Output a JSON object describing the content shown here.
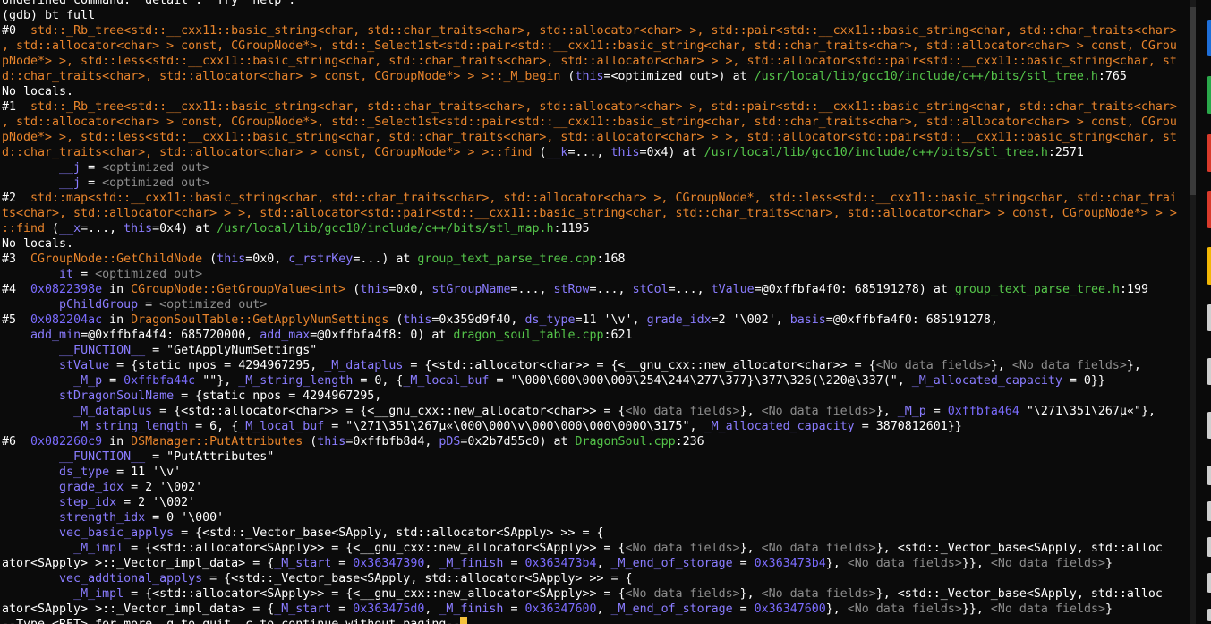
{
  "terminal": {
    "cursor_color": "#f5c23b",
    "lines": [
      [
        {
          "t": "Undefined command: \"detail\".  Try \"help\".",
          "c": "plain"
        }
      ],
      [
        {
          "t": "(gdb) bt full",
          "c": "plain"
        }
      ],
      [
        {
          "t": "#0  ",
          "c": "plain"
        },
        {
          "t": "std::_Rb_tree<std::__cxx11::basic_string<char, std::char_traits<char>, std::allocator<char> >, std::pair<std::__cxx11::basic_string<char, std::char_traits<char>",
          "c": "func"
        }
      ],
      [
        {
          "t": ", std::allocator<char> > const, CGroupNode*>, std::_Select1st<std::pair<std::__cxx11::basic_string<char, std::char_traits<char>, std::allocator<char> > const, CGrou",
          "c": "func"
        }
      ],
      [
        {
          "t": "pNode*> >, std::less<std::__cxx11::basic_string<char, std::char_traits<char>, std::allocator<char> > >, std::allocator<std::pair<std::__cxx11::basic_string<char, st",
          "c": "func"
        }
      ],
      [
        {
          "t": "d::char_traits<char>, std::allocator<char> > const, CGroupNode*> > >::_M_begin",
          "c": "func"
        },
        {
          "t": " (",
          "c": "plain"
        },
        {
          "t": "this",
          "c": "arg"
        },
        {
          "t": "=<optimized out>) at ",
          "c": "plain"
        },
        {
          "t": "/usr/local/lib/gcc10/include/c++/bits/stl_tree.h",
          "c": "file"
        },
        {
          "t": ":765",
          "c": "plain"
        }
      ],
      [
        {
          "t": "No locals.",
          "c": "plain"
        }
      ],
      [
        {
          "t": "#1  ",
          "c": "plain"
        },
        {
          "t": "std::_Rb_tree<std::__cxx11::basic_string<char, std::char_traits<char>, std::allocator<char> >, std::pair<std::__cxx11::basic_string<char, std::char_traits<char>",
          "c": "func"
        }
      ],
      [
        {
          "t": ", std::allocator<char> > const, CGroupNode*>, std::_Select1st<std::pair<std::__cxx11::basic_string<char, std::char_traits<char>, std::allocator<char> > const, CGrou",
          "c": "func"
        }
      ],
      [
        {
          "t": "pNode*> >, std::less<std::__cxx11::basic_string<char, std::char_traits<char>, std::allocator<char> > >, std::allocator<std::pair<std::__cxx11::basic_string<char, st",
          "c": "func"
        }
      ],
      [
        {
          "t": "d::char_traits<char>, std::allocator<char> > const, CGroupNode*> > >::find",
          "c": "func"
        },
        {
          "t": " (",
          "c": "plain"
        },
        {
          "t": "__k",
          "c": "arg"
        },
        {
          "t": "=..., ",
          "c": "plain"
        },
        {
          "t": "this",
          "c": "arg"
        },
        {
          "t": "=0x4) at ",
          "c": "plain"
        },
        {
          "t": "/usr/local/lib/gcc10/include/c++/bits/stl_tree.h",
          "c": "file"
        },
        {
          "t": ":2571",
          "c": "plain"
        }
      ],
      [
        {
          "t": "        ",
          "c": "plain"
        },
        {
          "t": "__j",
          "c": "arg"
        },
        {
          "t": " = ",
          "c": "plain"
        },
        {
          "t": "<optimized out>",
          "c": "dim"
        }
      ],
      [
        {
          "t": "        ",
          "c": "plain"
        },
        {
          "t": "__j",
          "c": "arg"
        },
        {
          "t": " = ",
          "c": "plain"
        },
        {
          "t": "<optimized out>",
          "c": "dim"
        }
      ],
      [
        {
          "t": "#2  ",
          "c": "plain"
        },
        {
          "t": "std::map<std::__cxx11::basic_string<char, std::char_traits<char>, std::allocator<char> >, CGroupNode*, std::less<std::__cxx11::basic_string<char, std::char_trai",
          "c": "func"
        }
      ],
      [
        {
          "t": "ts<char>, std::allocator<char> > >, std::allocator<std::pair<std::__cxx11::basic_string<char, std::char_traits<char>, std::allocator<char> > const, CGroupNode*> > >",
          "c": "func"
        }
      ],
      [
        {
          "t": "::find",
          "c": "func"
        },
        {
          "t": " (",
          "c": "plain"
        },
        {
          "t": "__x",
          "c": "arg"
        },
        {
          "t": "=..., ",
          "c": "plain"
        },
        {
          "t": "this",
          "c": "arg"
        },
        {
          "t": "=0x4) at ",
          "c": "plain"
        },
        {
          "t": "/usr/local/lib/gcc10/include/c++/bits/stl_map.h",
          "c": "file"
        },
        {
          "t": ":1195",
          "c": "plain"
        }
      ],
      [
        {
          "t": "No locals.",
          "c": "plain"
        }
      ],
      [
        {
          "t": "#3  ",
          "c": "plain"
        },
        {
          "t": "CGroupNode::GetChildNode",
          "c": "func"
        },
        {
          "t": " (",
          "c": "plain"
        },
        {
          "t": "this",
          "c": "arg"
        },
        {
          "t": "=0x0, ",
          "c": "plain"
        },
        {
          "t": "c_rstrKey",
          "c": "arg"
        },
        {
          "t": "=...) at ",
          "c": "plain"
        },
        {
          "t": "group_text_parse_tree.cpp",
          "c": "file"
        },
        {
          "t": ":168",
          "c": "plain"
        }
      ],
      [
        {
          "t": "        ",
          "c": "plain"
        },
        {
          "t": "it",
          "c": "arg"
        },
        {
          "t": " = ",
          "c": "plain"
        },
        {
          "t": "<optimized out>",
          "c": "dim"
        }
      ],
      [
        {
          "t": "#4  ",
          "c": "plain"
        },
        {
          "t": "0x0822398e",
          "c": "addr"
        },
        {
          "t": " in ",
          "c": "plain"
        },
        {
          "t": "CGroupNode::GetGroupValue<int>",
          "c": "func"
        },
        {
          "t": " (",
          "c": "plain"
        },
        {
          "t": "this",
          "c": "arg"
        },
        {
          "t": "=0x0, ",
          "c": "plain"
        },
        {
          "t": "stGroupName",
          "c": "arg"
        },
        {
          "t": "=..., ",
          "c": "plain"
        },
        {
          "t": "stRow",
          "c": "arg"
        },
        {
          "t": "=..., ",
          "c": "plain"
        },
        {
          "t": "stCol",
          "c": "arg"
        },
        {
          "t": "=..., ",
          "c": "plain"
        },
        {
          "t": "tValue",
          "c": "arg"
        },
        {
          "t": "=@0xffbfa4f0: 685191278) at ",
          "c": "plain"
        },
        {
          "t": "group_text_parse_tree.h",
          "c": "file"
        },
        {
          "t": ":199",
          "c": "plain"
        }
      ],
      [
        {
          "t": "        ",
          "c": "plain"
        },
        {
          "t": "pChildGroup",
          "c": "arg"
        },
        {
          "t": " = ",
          "c": "plain"
        },
        {
          "t": "<optimized out>",
          "c": "dim"
        }
      ],
      [
        {
          "t": "#5  ",
          "c": "plain"
        },
        {
          "t": "0x082204ac",
          "c": "addr"
        },
        {
          "t": " in ",
          "c": "plain"
        },
        {
          "t": "DragonSoulTable::GetApplyNumSettings",
          "c": "func"
        },
        {
          "t": " (",
          "c": "plain"
        },
        {
          "t": "this",
          "c": "arg"
        },
        {
          "t": "=0x359d9f40, ",
          "c": "plain"
        },
        {
          "t": "ds_type",
          "c": "arg"
        },
        {
          "t": "=11 '\\v', ",
          "c": "plain"
        },
        {
          "t": "grade_idx",
          "c": "arg"
        },
        {
          "t": "=2 '\\002', ",
          "c": "plain"
        },
        {
          "t": "basis",
          "c": "arg"
        },
        {
          "t": "=@0xffbfa4f0: 685191278,",
          "c": "plain"
        }
      ],
      [
        {
          "t": "    ",
          "c": "plain"
        },
        {
          "t": "add_min",
          "c": "arg"
        },
        {
          "t": "=@0xffbfa4f4: 685720000, ",
          "c": "plain"
        },
        {
          "t": "add_max",
          "c": "arg"
        },
        {
          "t": "=@0xffbfa4f8: 0) at ",
          "c": "plain"
        },
        {
          "t": "dragon_soul_table.cpp",
          "c": "file"
        },
        {
          "t": ":621",
          "c": "plain"
        }
      ],
      [
        {
          "t": "        ",
          "c": "plain"
        },
        {
          "t": "__FUNCTION__",
          "c": "arg"
        },
        {
          "t": " = \"GetApplyNumSettings\"",
          "c": "plain"
        }
      ],
      [
        {
          "t": "        ",
          "c": "plain"
        },
        {
          "t": "stValue",
          "c": "arg"
        },
        {
          "t": " = {static npos = 4294967295, ",
          "c": "plain"
        },
        {
          "t": "_M_dataplus",
          "c": "arg"
        },
        {
          "t": " = {<std::allocator<char>> = {<__gnu_cxx::new_allocator<char>> = {",
          "c": "plain"
        },
        {
          "t": "<No data fields>",
          "c": "dim"
        },
        {
          "t": "}, ",
          "c": "plain"
        },
        {
          "t": "<No data fields>",
          "c": "dim"
        },
        {
          "t": "},",
          "c": "plain"
        }
      ],
      [
        {
          "t": "          ",
          "c": "plain"
        },
        {
          "t": "_M_p",
          "c": "arg"
        },
        {
          "t": " = ",
          "c": "plain"
        },
        {
          "t": "0xffbfa44c",
          "c": "addr"
        },
        {
          "t": " \"\"}, ",
          "c": "plain"
        },
        {
          "t": "_M_string_length",
          "c": "arg"
        },
        {
          "t": " = 0, {",
          "c": "plain"
        },
        {
          "t": "_M_local_buf",
          "c": "arg"
        },
        {
          "t": " = \"\\000\\000\\000\\000\\254\\244\\277\\377}\\377\\326(\\220@\\337(\", ",
          "c": "plain"
        },
        {
          "t": "_M_allocated_capacity",
          "c": "arg"
        },
        {
          "t": " = 0}}",
          "c": "plain"
        }
      ],
      [
        {
          "t": "        ",
          "c": "plain"
        },
        {
          "t": "stDragonSoulName",
          "c": "arg"
        },
        {
          "t": " = {static npos = 4294967295,",
          "c": "plain"
        }
      ],
      [
        {
          "t": "          ",
          "c": "plain"
        },
        {
          "t": "_M_dataplus",
          "c": "arg"
        },
        {
          "t": " = {<std::allocator<char>> = {<__gnu_cxx::new_allocator<char>> = {",
          "c": "plain"
        },
        {
          "t": "<No data fields>",
          "c": "dim"
        },
        {
          "t": "}, ",
          "c": "plain"
        },
        {
          "t": "<No data fields>",
          "c": "dim"
        },
        {
          "t": "}, ",
          "c": "plain"
        },
        {
          "t": "_M_p",
          "c": "arg"
        },
        {
          "t": " = ",
          "c": "plain"
        },
        {
          "t": "0xffbfa464",
          "c": "addr"
        },
        {
          "t": " \"\\271\\351\\267µ«\"},",
          "c": "plain"
        }
      ],
      [
        {
          "t": "          ",
          "c": "plain"
        },
        {
          "t": "_M_string_length",
          "c": "arg"
        },
        {
          "t": " = 6, {",
          "c": "plain"
        },
        {
          "t": "_M_local_buf",
          "c": "arg"
        },
        {
          "t": " = \"\\271\\351\\267µ«\\000\\000\\v\\000\\000\\000\\000O\\3175\", ",
          "c": "plain"
        },
        {
          "t": "_M_allocated_capacity",
          "c": "arg"
        },
        {
          "t": " = 3870812601}}",
          "c": "plain"
        }
      ],
      [
        {
          "t": "#6  ",
          "c": "plain"
        },
        {
          "t": "0x082260c9",
          "c": "addr"
        },
        {
          "t": " in ",
          "c": "plain"
        },
        {
          "t": "DSManager::PutAttributes",
          "c": "func"
        },
        {
          "t": " (",
          "c": "plain"
        },
        {
          "t": "this",
          "c": "arg"
        },
        {
          "t": "=0xffbfb8d4, ",
          "c": "plain"
        },
        {
          "t": "pDS",
          "c": "arg"
        },
        {
          "t": "=0x2b7d55c0) at ",
          "c": "plain"
        },
        {
          "t": "DragonSoul.cpp",
          "c": "file"
        },
        {
          "t": ":236",
          "c": "plain"
        }
      ],
      [
        {
          "t": "        ",
          "c": "plain"
        },
        {
          "t": "__FUNCTION__",
          "c": "arg"
        },
        {
          "t": " = \"PutAttributes\"",
          "c": "plain"
        }
      ],
      [
        {
          "t": "        ",
          "c": "plain"
        },
        {
          "t": "ds_type",
          "c": "arg"
        },
        {
          "t": " = 11 '\\v'",
          "c": "plain"
        }
      ],
      [
        {
          "t": "        ",
          "c": "plain"
        },
        {
          "t": "grade_idx",
          "c": "arg"
        },
        {
          "t": " = 2 '\\002'",
          "c": "plain"
        }
      ],
      [
        {
          "t": "        ",
          "c": "plain"
        },
        {
          "t": "step_idx",
          "c": "arg"
        },
        {
          "t": " = 2 '\\002'",
          "c": "plain"
        }
      ],
      [
        {
          "t": "        ",
          "c": "plain"
        },
        {
          "t": "strength_idx",
          "c": "arg"
        },
        {
          "t": " = 0 '\\000'",
          "c": "plain"
        }
      ],
      [
        {
          "t": "        ",
          "c": "plain"
        },
        {
          "t": "vec_basic_applys",
          "c": "arg"
        },
        {
          "t": " = {<std::_Vector_base<SApply, std::allocator<SApply> >> = {",
          "c": "plain"
        }
      ],
      [
        {
          "t": "          ",
          "c": "plain"
        },
        {
          "t": "_M_impl",
          "c": "arg"
        },
        {
          "t": " = {<std::allocator<SApply>> = {<__gnu_cxx::new_allocator<SApply>> = {",
          "c": "plain"
        },
        {
          "t": "<No data fields>",
          "c": "dim"
        },
        {
          "t": "}, ",
          "c": "plain"
        },
        {
          "t": "<No data fields>",
          "c": "dim"
        },
        {
          "t": "}, <std::_Vector_base<SApply, std::alloc",
          "c": "plain"
        }
      ],
      [
        {
          "t": "ator<SApply> >::_Vector_impl_data> = {",
          "c": "plain"
        },
        {
          "t": "_M_start",
          "c": "arg"
        },
        {
          "t": " = ",
          "c": "plain"
        },
        {
          "t": "0x36347390",
          "c": "addr"
        },
        {
          "t": ", ",
          "c": "plain"
        },
        {
          "t": "_M_finish",
          "c": "arg"
        },
        {
          "t": " = ",
          "c": "plain"
        },
        {
          "t": "0x363473b4",
          "c": "addr"
        },
        {
          "t": ", ",
          "c": "plain"
        },
        {
          "t": "_M_end_of_storage",
          "c": "arg"
        },
        {
          "t": " = ",
          "c": "plain"
        },
        {
          "t": "0x363473b4",
          "c": "addr"
        },
        {
          "t": "}, ",
          "c": "plain"
        },
        {
          "t": "<No data fields>",
          "c": "dim"
        },
        {
          "t": "}}, ",
          "c": "plain"
        },
        {
          "t": "<No data fields>",
          "c": "dim"
        },
        {
          "t": "}",
          "c": "plain"
        }
      ],
      [
        {
          "t": "        ",
          "c": "plain"
        },
        {
          "t": "vec_addtional_applys",
          "c": "arg"
        },
        {
          "t": " = {<std::_Vector_base<SApply, std::allocator<SApply> >> = {",
          "c": "plain"
        }
      ],
      [
        {
          "t": "          ",
          "c": "plain"
        },
        {
          "t": "_M_impl",
          "c": "arg"
        },
        {
          "t": " = {<std::allocator<SApply>> = {<__gnu_cxx::new_allocator<SApply>> = {",
          "c": "plain"
        },
        {
          "t": "<No data fields>",
          "c": "dim"
        },
        {
          "t": "}, ",
          "c": "plain"
        },
        {
          "t": "<No data fields>",
          "c": "dim"
        },
        {
          "t": "}, <std::_Vector_base<SApply, std::alloc",
          "c": "plain"
        }
      ],
      [
        {
          "t": "ator<SApply> >::_Vector_impl_data> = {",
          "c": "plain"
        },
        {
          "t": "_M_start",
          "c": "arg"
        },
        {
          "t": " = ",
          "c": "plain"
        },
        {
          "t": "0x363475d0",
          "c": "addr"
        },
        {
          "t": ", ",
          "c": "plain"
        },
        {
          "t": "_M_finish",
          "c": "arg"
        },
        {
          "t": " = ",
          "c": "plain"
        },
        {
          "t": "0x36347600",
          "c": "addr"
        },
        {
          "t": ", ",
          "c": "plain"
        },
        {
          "t": "_M_end_of_storage",
          "c": "arg"
        },
        {
          "t": " = ",
          "c": "plain"
        },
        {
          "t": "0x36347600",
          "c": "addr"
        },
        {
          "t": "}, ",
          "c": "plain"
        },
        {
          "t": "<No data fields>",
          "c": "dim"
        },
        {
          "t": "}}, ",
          "c": "plain"
        },
        {
          "t": "<No data fields>",
          "c": "dim"
        },
        {
          "t": "}",
          "c": "plain"
        }
      ],
      [
        {
          "t": "--Type <RET> for more, q to quit, c to continue without paging--",
          "c": "plain"
        }
      ]
    ]
  },
  "side_tabs": [
    {
      "color": "#1e6fd9"
    },
    {
      "color": "#2aa84a"
    },
    {
      "color": "#d93a2b"
    },
    {
      "color": "#d93a2b"
    },
    {
      "color": "#f2b705"
    },
    {
      "color": "#cfcfcf"
    },
    {
      "color": "#cfcfcf"
    },
    {
      "color": "#cfcfcf"
    },
    {
      "color": "#cfcfcf"
    },
    {
      "color": "#cfcfcf"
    },
    {
      "color": "#cfcfcf"
    },
    {
      "color": "#cfcfcf"
    },
    {
      "color": "#cfcfcf"
    }
  ]
}
